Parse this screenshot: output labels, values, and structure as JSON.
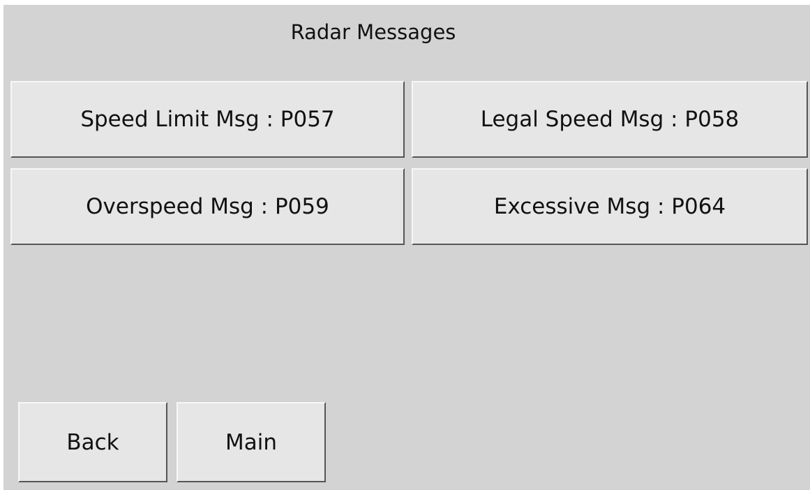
{
  "screen": {
    "title": "Radar Messages",
    "background_color": "#d3d3d3",
    "button_color": "#e6e6e6"
  },
  "message_buttons": [
    {
      "label": "Speed Limit Msg : P057"
    },
    {
      "label": "Legal Speed Msg : P058"
    },
    {
      "label": "Overspeed Msg : P059"
    },
    {
      "label": "Excessive Msg : P064"
    }
  ],
  "nav": {
    "back_label": "Back",
    "main_label": "Main"
  }
}
